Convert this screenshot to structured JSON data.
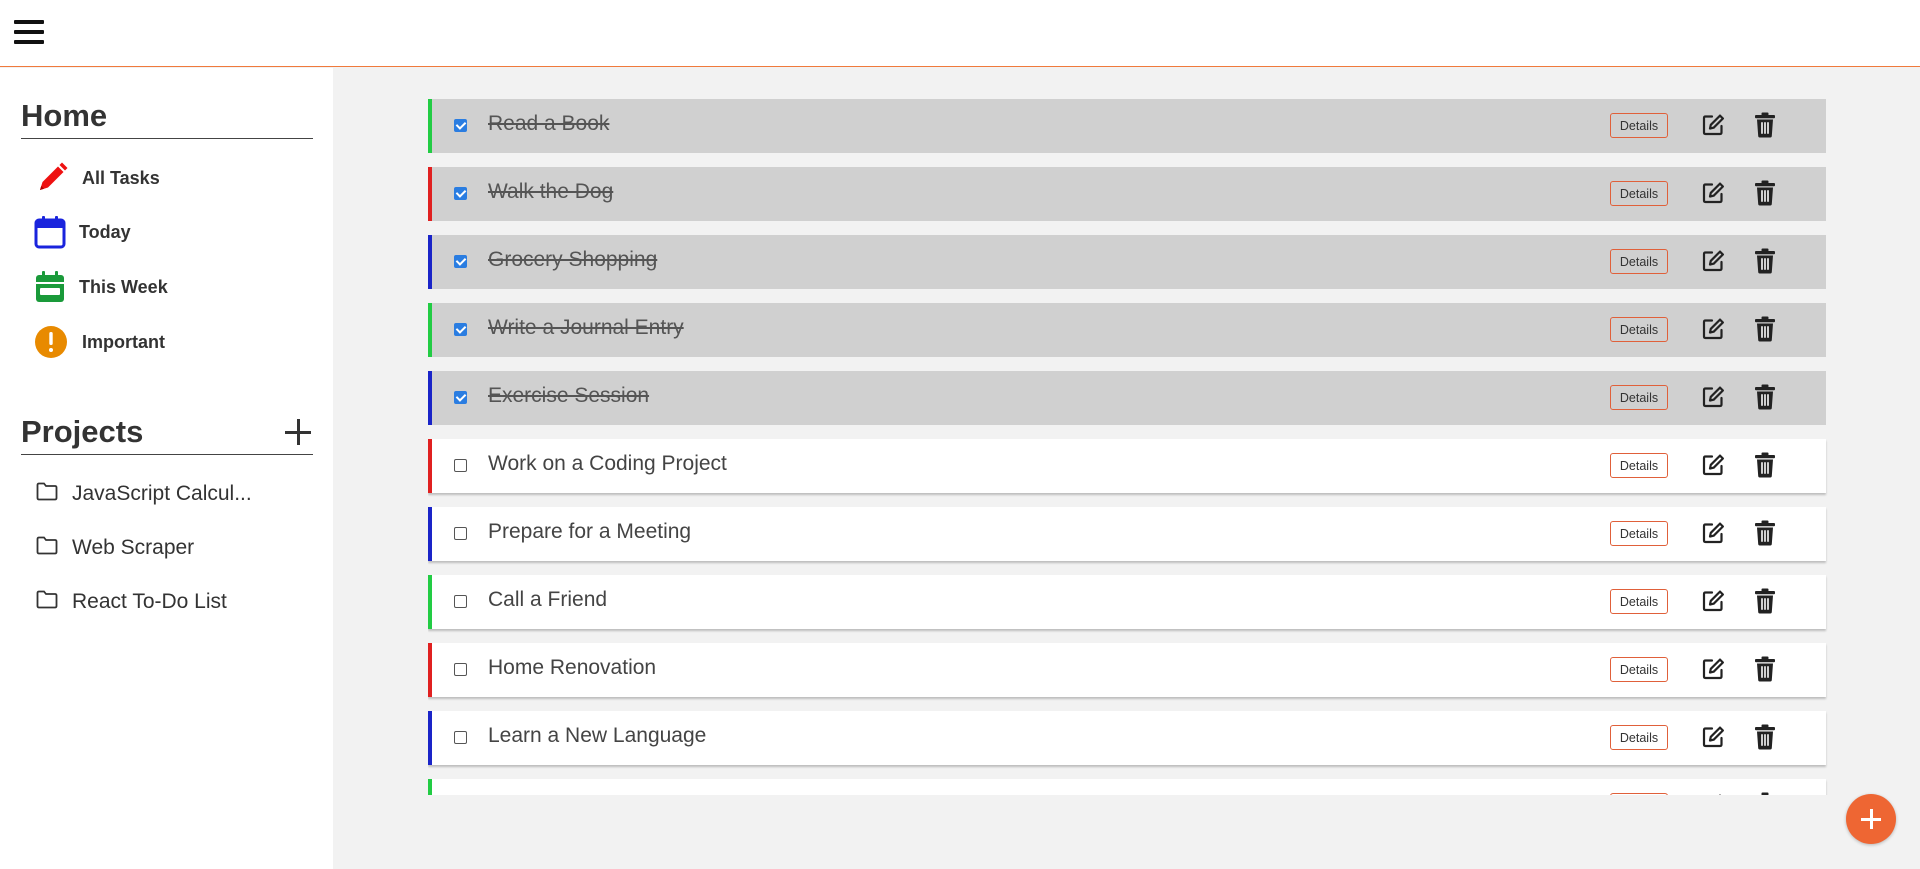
{
  "colors": {
    "accent": "#ee6633",
    "green": "#22cc44",
    "red": "#e02020",
    "blue": "#1a24c8",
    "checked": "#2a7de1",
    "orange": "#e88a00"
  },
  "header": {
    "menu_icon": "hamburger-menu-icon"
  },
  "sidebar": {
    "home_title": "Home",
    "nav": [
      {
        "label": "All Tasks",
        "icon": "pencil-icon",
        "color": "#ee1111"
      },
      {
        "label": "Today",
        "icon": "calendar-icon",
        "color": "#1a24dd"
      },
      {
        "label": "This Week",
        "icon": "calendar-week-icon",
        "color": "#1a9a3a"
      },
      {
        "label": "Important",
        "icon": "exclamation-circle-icon",
        "color": "#e88a00"
      }
    ],
    "projects_title": "Projects",
    "projects": [
      {
        "label": "JavaScript Calcul...",
        "icon": "folder-icon"
      },
      {
        "label": "Web Scraper",
        "icon": "folder-icon"
      },
      {
        "label": "React To-Do List",
        "icon": "folder-icon"
      }
    ]
  },
  "tasks": [
    {
      "title": "Read a Book",
      "done": true,
      "priority": "green",
      "details_label": "Details"
    },
    {
      "title": "Walk the Dog",
      "done": true,
      "priority": "red",
      "details_label": "Details"
    },
    {
      "title": "Grocery Shopping",
      "done": true,
      "priority": "blue",
      "details_label": "Details"
    },
    {
      "title": "Write a Journal Entry",
      "done": true,
      "priority": "green",
      "details_label": "Details"
    },
    {
      "title": "Exercise Session",
      "done": true,
      "priority": "blue",
      "details_label": "Details"
    },
    {
      "title": "Work on a Coding Project",
      "done": false,
      "priority": "red",
      "details_label": "Details"
    },
    {
      "title": "Prepare for a Meeting",
      "done": false,
      "priority": "blue",
      "details_label": "Details"
    },
    {
      "title": "Call a Friend",
      "done": false,
      "priority": "green",
      "details_label": "Details"
    },
    {
      "title": "Home Renovation",
      "done": false,
      "priority": "red",
      "details_label": "Details"
    },
    {
      "title": "Learn a New Language",
      "done": false,
      "priority": "blue",
      "details_label": "Details"
    },
    {
      "title": "",
      "done": false,
      "priority": "green",
      "details_label": "Details"
    }
  ]
}
